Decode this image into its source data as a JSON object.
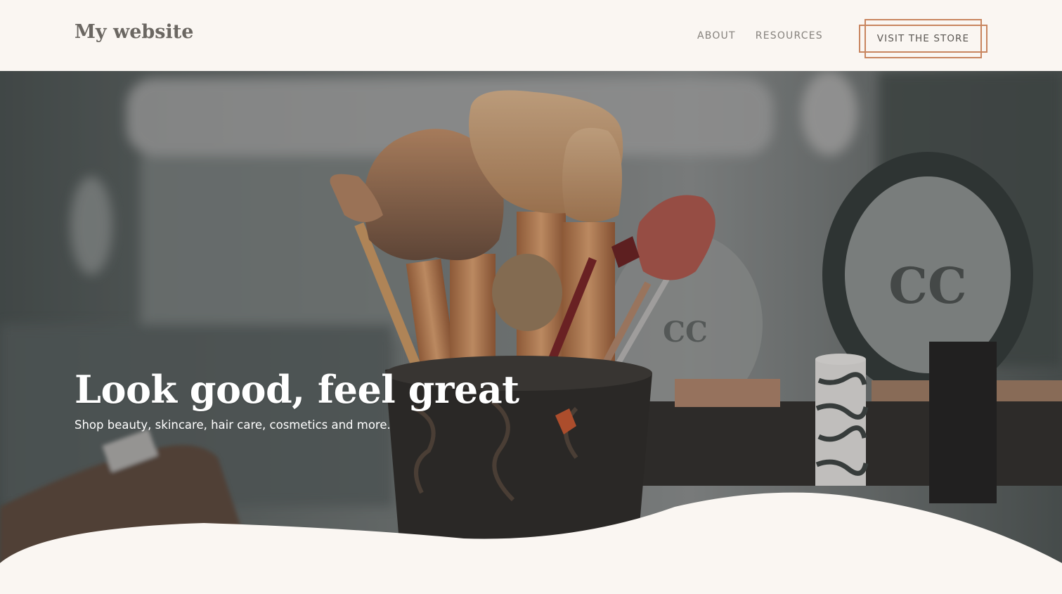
{
  "header": {
    "logo": "My website",
    "nav": [
      {
        "label": "ABOUT"
      },
      {
        "label": "RESOURCES"
      }
    ],
    "cta_label": "VISIT THE STORE"
  },
  "hero": {
    "headline": "Look good, feel great",
    "subline": "Shop beauty, skincare, hair care, cosmetics and more.",
    "image_subject": "makeup brushes in a cup with cosmetics"
  },
  "colors": {
    "background": "#faf6f2",
    "accent": "#c8855f",
    "text_muted": "#85817c",
    "logo": "#6b6762",
    "hero_overlay": "#4a5150"
  }
}
